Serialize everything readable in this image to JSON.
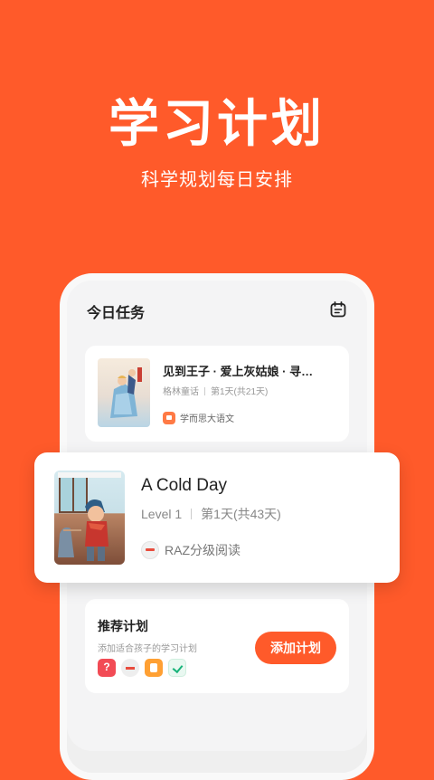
{
  "hero": {
    "title": "学习计划",
    "subtitle": "科学规划每日安排"
  },
  "screen": {
    "title": "今日任务",
    "calendar_icon": "calendar-icon"
  },
  "tasks": [
    {
      "title": "见到王子 · 爱上灰姑娘 · 寻…",
      "category": "格林童话",
      "progress": "第1天(共21天)",
      "source": "学而思大语文",
      "cover_label": "格林童话"
    },
    {
      "title": "A Cold Day",
      "level": "Level 1",
      "progress": "第1天(共43天)",
      "source": "RAZ分级阅读"
    }
  ],
  "recommend": {
    "title": "推荐计划",
    "subtitle": "添加适合孩子的学习计划",
    "button": "添加计划",
    "icons": [
      "question-app-icon",
      "raz-app-icon",
      "note-app-icon",
      "check-app-icon"
    ]
  },
  "colors": {
    "brand": "#FF5A2A",
    "card": "#FFFFFF",
    "screen_bg": "#F4F4F5"
  }
}
